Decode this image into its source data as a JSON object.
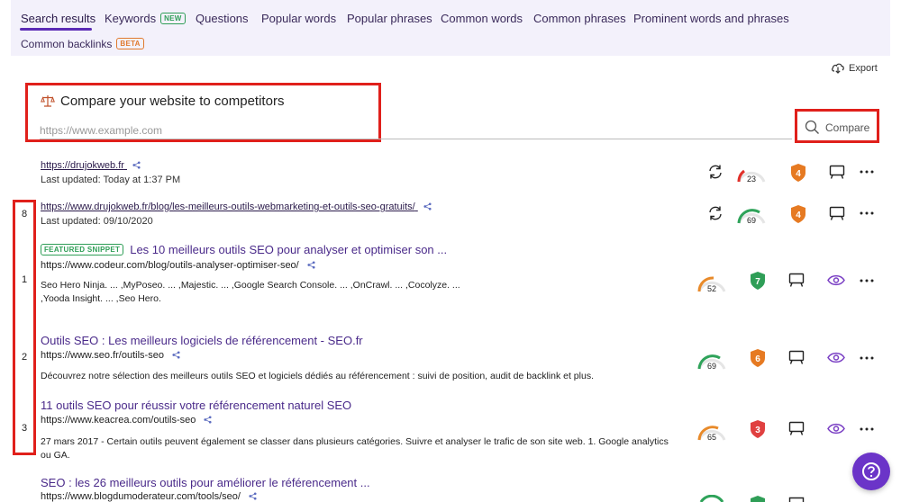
{
  "tabs": [
    {
      "label": "Search results"
    },
    {
      "label": "Keywords",
      "badge": "NEW"
    },
    {
      "label": "Questions"
    },
    {
      "label": "Popular words"
    },
    {
      "label": "Popular phrases"
    },
    {
      "label": "Common words"
    },
    {
      "label": "Common phrases"
    },
    {
      "label": "Prominent words and phrases"
    },
    {
      "label": "Common backlinks",
      "badge": "BETA"
    }
  ],
  "toolbar": {
    "export_label": "Export"
  },
  "compare": {
    "title": "Compare your website to competitors",
    "placeholder": "https://www.example.com",
    "button_label": "Compare"
  },
  "tracked_sites": [
    {
      "url": "https://drujokweb.fr",
      "updated": "Last updated: Today at 1:37 PM",
      "score": "23",
      "authority": "4"
    },
    {
      "url": "https://www.drujokweb.fr/blog/les-meilleurs-outils-webmarketing-et-outils-seo-gratuits/",
      "updated": "Last updated: 09/10/2020",
      "rank": "8",
      "score": "69",
      "authority": "4"
    }
  ],
  "results": [
    {
      "rank": "1",
      "snippet_badge": "FEATURED SNIPPET",
      "title": "Les 10 meilleurs outils SEO pour analyser et optimiser son ...",
      "url": "https://www.codeur.com/blog/outils-analyser-optimiser-seo/",
      "description": "Seo Hero Ninja. ... ,MyPoseo. ... ,Majestic. ... ,Google Search Console. ... ,OnCrawl. ... ,Cocolyze. ... ,Yooda Insight. ... ,Seo Hero.",
      "score": "52",
      "authority": "7"
    },
    {
      "rank": "2",
      "title": "Outils SEO : Les meilleurs logiciels de référencement - SEO.fr",
      "url": "https://www.seo.fr/outils-seo",
      "description": "Découvrez notre sélection des meilleurs outils SEO et logiciels dédiés au référencement : suivi de position, audit de backlink et plus.",
      "score": "69",
      "authority": "6"
    },
    {
      "rank": "3",
      "title": "11 outils SEO pour réussir votre référencement naturel SEO",
      "url": "https://www.keacrea.com/outils-seo",
      "description": "27 mars 2017 - Certain outils peuvent également se classer dans plusieurs catégories. Suivre et analyser le trafic de son site web. 1. Google analytics ou GA.",
      "score": "65",
      "authority": "3"
    },
    {
      "title": "SEO : les 26 meilleurs outils pour améliorer le référencement ...",
      "url": "https://www.blogdumoderateur.com/tools/seo/"
    }
  ],
  "colors": {
    "accent": "#5b2bb5",
    "tab_bar_bg": "#f3f1fb",
    "highlight": "#e0201b",
    "gauge_low": "#e0302a",
    "gauge_mid": "#e88a2a",
    "gauge_high": "#2fa35a",
    "shield_orange": "#e67a22",
    "shield_green": "#2f9e57",
    "shield_red": "#e04040",
    "help_button": "#6b34c8"
  }
}
